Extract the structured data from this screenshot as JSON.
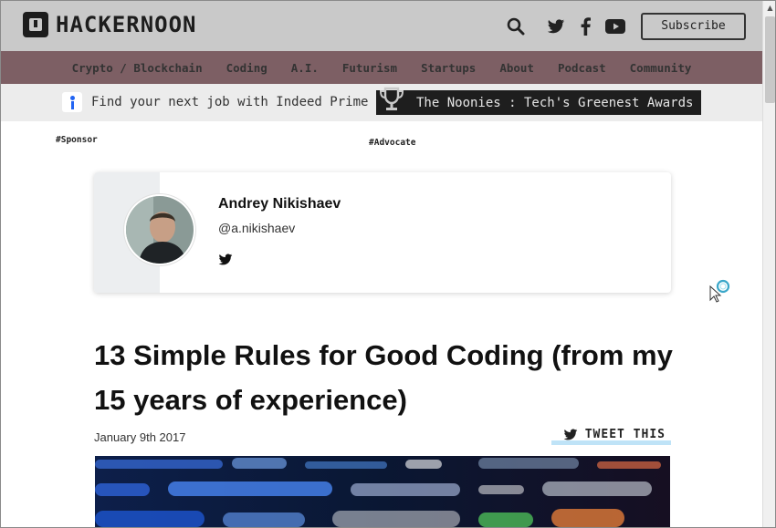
{
  "header": {
    "logo_text": "HACKERNOON",
    "subscribe_label": "Subscribe",
    "icons": [
      "search-icon",
      "twitter-icon",
      "facebook-icon",
      "youtube-icon"
    ]
  },
  "nav": {
    "items": [
      "Crypto / Blockchain",
      "Coding",
      "A.I.",
      "Futurism",
      "Startups",
      "About",
      "Podcast",
      "Community"
    ]
  },
  "promo": {
    "indeed_text": "Find your next job with Indeed Prime",
    "noonies_text": "The Noonies : Tech's Greenest Awards"
  },
  "tags": {
    "sponsor": "#Sponsor",
    "advocate": "#Advocate"
  },
  "author": {
    "name": "Andrey Nikishaev",
    "handle": "@a.nikishaev"
  },
  "article": {
    "title": "13 Simple Rules for Good Coding (from my 15 years of experience)",
    "date": "January 9th 2017",
    "tweet_label": "TWEET THIS"
  },
  "colors": {
    "header_bg": "#c9c9c9",
    "nav_bg": "#7d5f64",
    "promo_bg": "#ececec",
    "noonies_bg": "#1e1e1e",
    "tweet_underline": "#bfe3f7"
  }
}
